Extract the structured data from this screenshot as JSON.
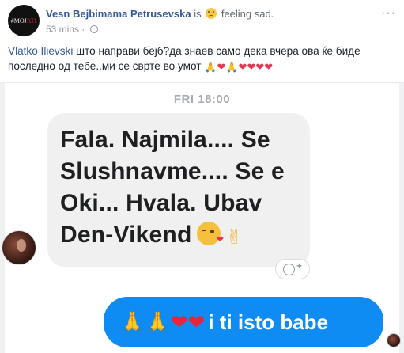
{
  "post": {
    "author": "Vesn Bejbimama Petrusevska",
    "status_verb": "is",
    "feeling": "feeling sad.",
    "time": "53 mins ·",
    "more_glyph": "···",
    "avatar_label_white": "#MOJ",
    "avatar_label_red": "ATI",
    "mention": "Vlatko Ilievski",
    "text_line_1": " што направи бејб?да знаев само дека вчера ова ќе биде",
    "text_line_2": "последно од тебе..ми се свртe во умот",
    "icons": {
      "author_status": "sad-face-icon",
      "privacy": "globe-icon",
      "more": "more-options-icon"
    }
  },
  "screenshot": {
    "timestamp": "FRI 18:00",
    "received_message": "Fala. Najmila.... Se Slushnavme.... Se e Oki... Hvala. Ubav Den-Vikend",
    "sent_message": "i ti isto babe",
    "icons": {
      "received_emojis": [
        "kissing-face-icon",
        "victory-hand-icon"
      ],
      "sent_emojis": [
        "folded-hands-icon",
        "folded-hands-icon",
        "red-heart-icon",
        "red-heart-icon"
      ],
      "react": "add-reaction-icon"
    }
  },
  "colors": {
    "link": "#365899",
    "sent_bubble": "#0f8bf4",
    "received_bubble": "#f1f0f0",
    "timestamp": "#a8abb0"
  }
}
